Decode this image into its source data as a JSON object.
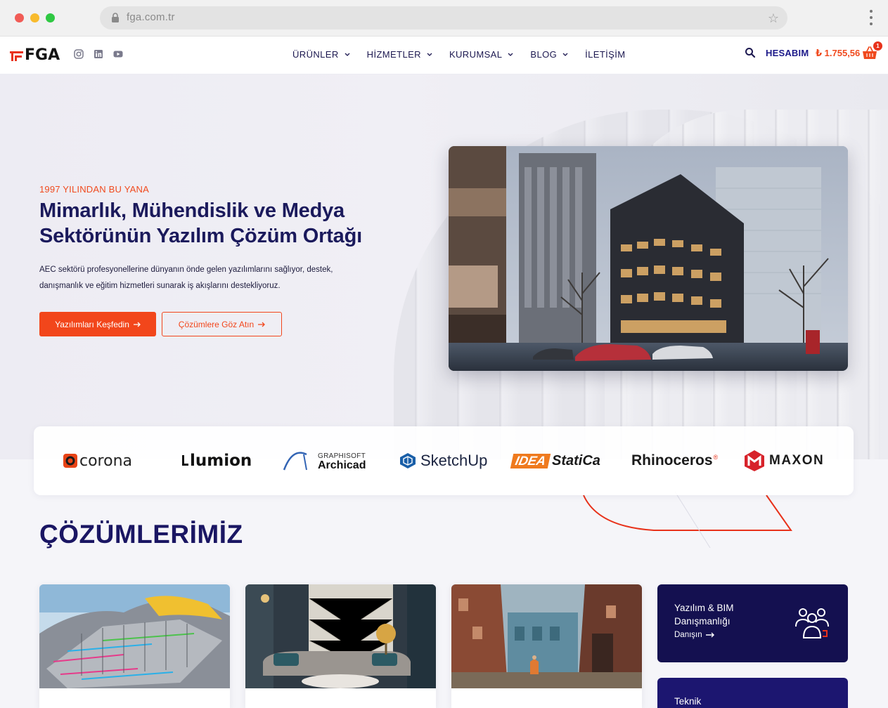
{
  "browser": {
    "url": "fga.com.tr"
  },
  "header": {
    "logo_text": "FGA",
    "social": [
      "instagram-icon",
      "linkedin-icon",
      "youtube-icon"
    ],
    "nav": [
      {
        "label": "ÜRÜNLER",
        "has_dropdown": true
      },
      {
        "label": "HİZMETLER",
        "has_dropdown": true
      },
      {
        "label": "KURUMSAL",
        "has_dropdown": true
      },
      {
        "label": "BLOG",
        "has_dropdown": true
      },
      {
        "label": "İLETİŞİM",
        "has_dropdown": false
      }
    ],
    "account_label": "HESABIM",
    "cart_total": "₺ 1.755,56",
    "cart_count": "1"
  },
  "hero": {
    "eyebrow": "1997 YILINDAN BU YANA",
    "title_line1": "Mimarlık, Mühendislik ve Medya",
    "title_line2": "Sektörünün Yazılım Çözüm Ortağı",
    "description": "AEC sektörü profesyonellerine dünyanın önde gelen yazılımlarını sağlıyor, destek, danışmanlık ve eğitim hizmetleri sunarak iş akışlarını destekliyoruz.",
    "primary_button": "Yazılımları Keşfedin",
    "secondary_button": "Çözümlere Göz Atın"
  },
  "partners": [
    {
      "name": "corona"
    },
    {
      "name": "lumion"
    },
    {
      "name": "Archicad",
      "top": "GRAPHISOFT"
    },
    {
      "name": "SketchUp"
    },
    {
      "name": "StatiCa",
      "prefix": "IDEA"
    },
    {
      "name": "Rhinoceros"
    },
    {
      "name": "MAXON"
    }
  ],
  "solutions": {
    "title": "ÇÖZÜMLERİMİZ",
    "services": [
      {
        "title": "Yazılım & BIM Danışmanlığı",
        "link": "Danışın"
      },
      {
        "title": "Teknik"
      }
    ]
  },
  "colors": {
    "brand_orange": "#f2461b",
    "brand_navy": "#1b1a5c",
    "card_navy": "#141050"
  }
}
